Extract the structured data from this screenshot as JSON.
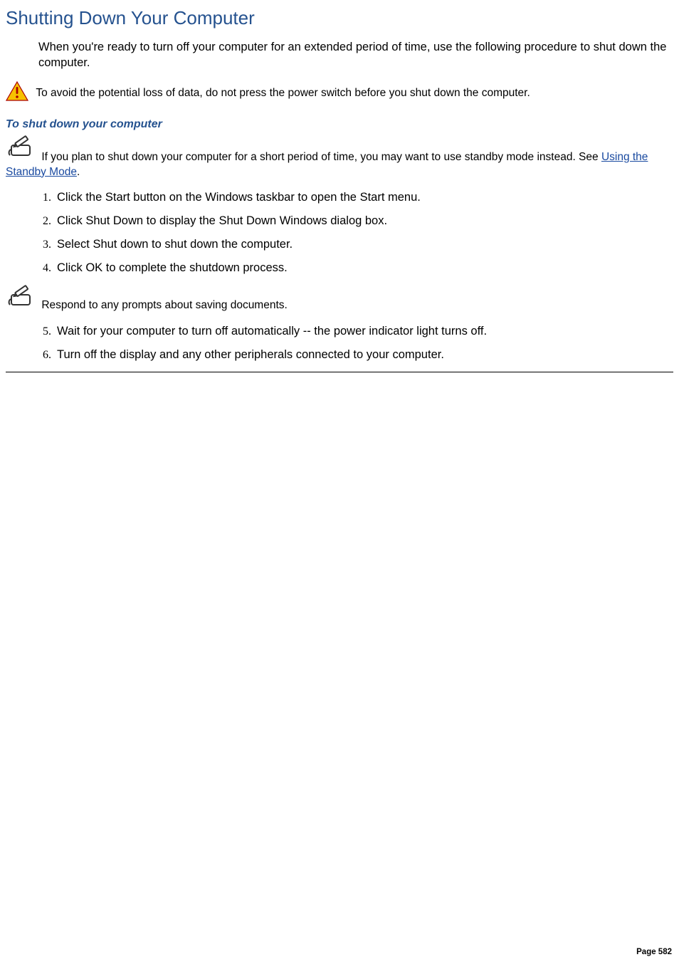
{
  "title": "Shutting Down Your Computer",
  "intro": "When you're ready to turn off your computer for an extended period of time, use the following procedure to shut down the computer.",
  "warning": "To avoid the potential loss of data, do not press the power switch before you shut down the computer.",
  "subhead": "To shut down your computer",
  "note1_prefix": "If you plan to shut down your computer for a short period of time, you may want to use standby mode instead. See ",
  "note1_link": "Using the Standby Mode",
  "note1_suffix": ".",
  "steps_a": [
    "Click the Start button on the Windows taskbar to open the Start menu.",
    "Click Shut Down to display the Shut Down Windows dialog box.",
    "Select Shut down to shut down the computer.",
    "Click OK to complete the shutdown process."
  ],
  "mid_note": "Respond to any prompts about saving documents.",
  "steps_b": [
    "Wait for your computer to turn off automatically -- the power indicator light turns off.",
    "Turn off the display and any other peripherals connected to your computer."
  ],
  "page_number": "Page 582",
  "colors": {
    "heading": "#25528f",
    "link": "#1a4aa0"
  },
  "icons": {
    "warning": "warning-triangle-icon",
    "note": "pencil-note-icon"
  }
}
